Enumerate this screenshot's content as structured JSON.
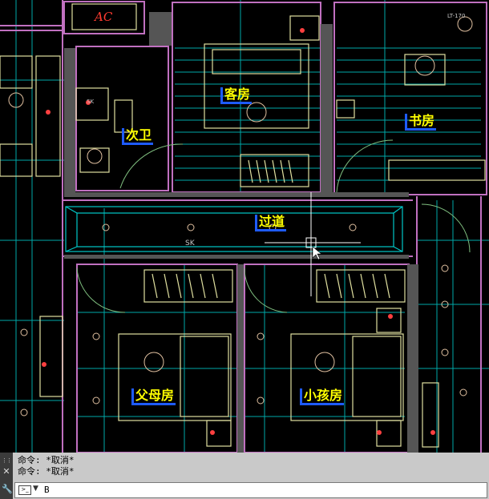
{
  "drawing": {
    "rooms": {
      "guest": "客房",
      "study": "书房",
      "bath": "次卫",
      "corridor": "过道",
      "parents": "父母房",
      "kids": "小孩房"
    },
    "tags": {
      "ac": "AC",
      "sk": "SK",
      "sk_small": "SK",
      "ceiling": "LT-170"
    }
  },
  "command_line": {
    "history": [
      "命令: *取消*",
      "命令: *取消*"
    ],
    "input_value": "B",
    "prompt_icon": "command-prompt-icon",
    "close_icon": "close-icon",
    "settings_icon": "wrench-icon"
  },
  "colors": {
    "wall": "#c070c0",
    "grid": "#00c8c8",
    "furniture": "#e0e0a0",
    "label_text": "#ffff00",
    "label_bar": "#1e5bff"
  }
}
